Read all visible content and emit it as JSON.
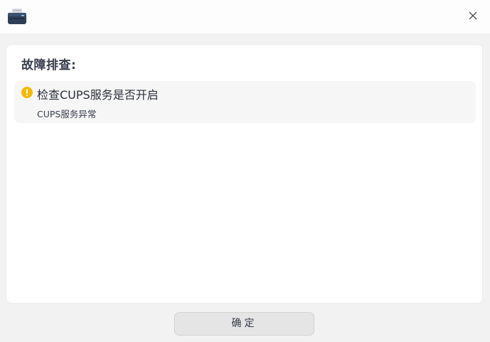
{
  "titlebar": {
    "app_icon": "printer-icon",
    "close_icon": "close-icon"
  },
  "troubleshoot": {
    "heading": "故障排查:",
    "items": [
      {
        "status": "warning",
        "icon": "warning-icon",
        "title": "检查CUPS服务是否开启",
        "detail": "CUPS服务异常"
      }
    ]
  },
  "footer": {
    "confirm_label": "确定"
  },
  "colors": {
    "warning": "#f5b800",
    "panel_bg": "#ffffff",
    "window_bg": "#f2f2f2"
  }
}
